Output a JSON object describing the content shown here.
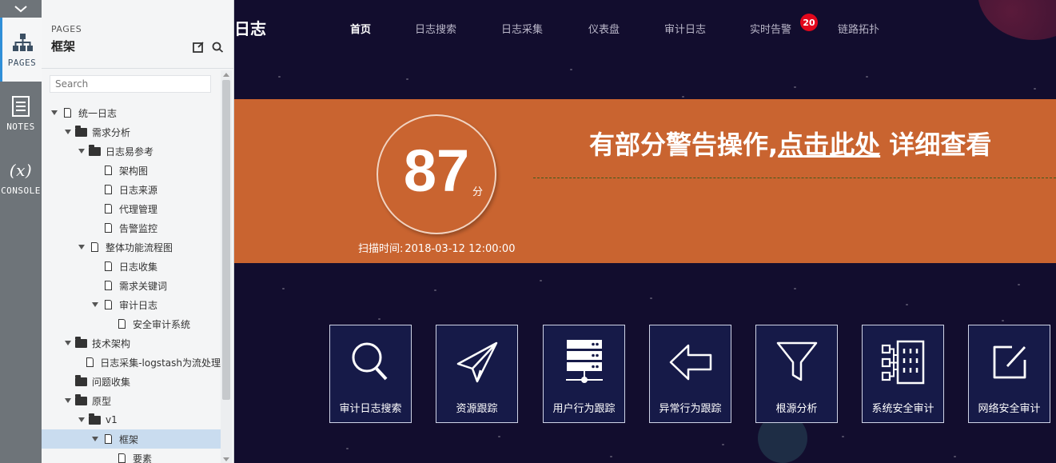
{
  "rail": {
    "pages_label": "PAGES",
    "notes_label": "NOTES",
    "console_label": "CONSOLE",
    "console_symbol": "(x)"
  },
  "panel": {
    "header_small": "PAGES",
    "header_title": "框架",
    "search_placeholder": "Search"
  },
  "tree": [
    {
      "label": "统一日志",
      "kind": "page",
      "level": 0,
      "expanded": true
    },
    {
      "label": "需求分析",
      "kind": "folder",
      "level": 1,
      "expanded": true
    },
    {
      "label": "日志易参考",
      "kind": "folder",
      "level": 2,
      "expanded": true
    },
    {
      "label": "架构图",
      "kind": "page",
      "level": 3
    },
    {
      "label": "日志来源",
      "kind": "page",
      "level": 3
    },
    {
      "label": "代理管理",
      "kind": "page",
      "level": 3
    },
    {
      "label": "告警监控",
      "kind": "page",
      "level": 3
    },
    {
      "label": "整体功能流程图",
      "kind": "page",
      "level": 2,
      "expanded": true
    },
    {
      "label": "日志收集",
      "kind": "page",
      "level": 3
    },
    {
      "label": "需求关键词",
      "kind": "page",
      "level": 3
    },
    {
      "label": "审计日志",
      "kind": "page",
      "level": 3,
      "expanded": true
    },
    {
      "label": "安全审计系统",
      "kind": "page",
      "level": 4
    },
    {
      "label": "技术架构",
      "kind": "folder",
      "level": 1,
      "expanded": true
    },
    {
      "label": "日志采集-logstash为流处理",
      "kind": "page",
      "level": 2
    },
    {
      "label": "问题收集",
      "kind": "folder",
      "level": 1
    },
    {
      "label": "原型",
      "kind": "folder",
      "level": 1,
      "expanded": true
    },
    {
      "label": "v1",
      "kind": "folder",
      "level": 2,
      "expanded": true
    },
    {
      "label": "框架",
      "kind": "page",
      "level": 3,
      "expanded": true,
      "selected": true
    },
    {
      "label": "要素",
      "kind": "page",
      "level": 4
    }
  ],
  "app": {
    "logo_text": "日志",
    "nav": [
      {
        "label": "首页",
        "active": true
      },
      {
        "label": "日志搜索"
      },
      {
        "label": "日志采集"
      },
      {
        "label": "仪表盘"
      },
      {
        "label": "审计日志"
      },
      {
        "label": "实时告警"
      },
      {
        "label": "链路拓扑"
      }
    ],
    "alert_count": "20",
    "score": "87",
    "score_unit": "分",
    "scan_label": "扫描时间:",
    "scan_time": "2018-03-12 12:00:00",
    "warning_prefix": "有部分警告操作,",
    "warning_link": "点击此处",
    "warning_suffix": " 详细查看",
    "tiles": [
      {
        "label": "审计日志搜索",
        "icon": "search-icon"
      },
      {
        "label": "资源跟踪",
        "icon": "paper-plane-icon"
      },
      {
        "label": "用户行为跟踪",
        "icon": "server-icon"
      },
      {
        "label": "异常行为跟踪",
        "icon": "arrow-left-icon"
      },
      {
        "label": "根源分析",
        "icon": "filter-icon"
      },
      {
        "label": "系统安全审计",
        "icon": "building-network-icon"
      },
      {
        "label": "网络安全审计",
        "icon": "edit-icon"
      }
    ],
    "colors": {
      "background": "#120d2e",
      "banner": "#c96430",
      "badge": "#e2071c",
      "tile": "#161a48"
    }
  }
}
